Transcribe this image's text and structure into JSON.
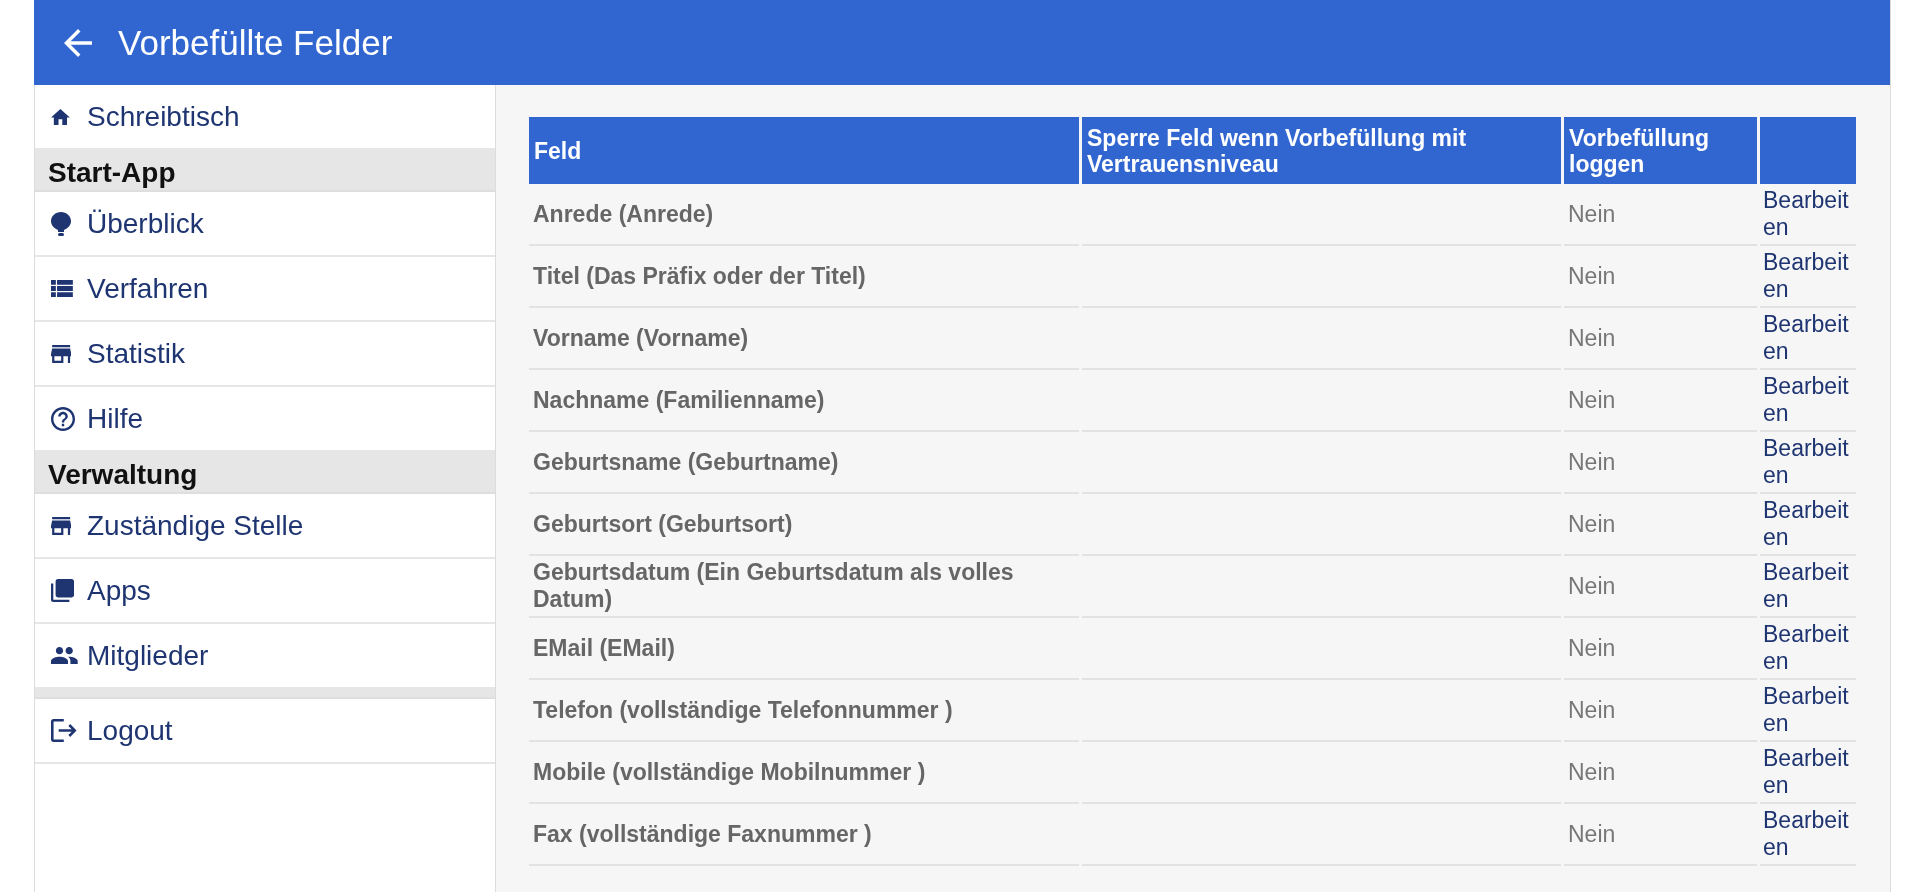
{
  "header": {
    "title": "Vorbefüllte Felder"
  },
  "sidebar": {
    "groups": [
      {
        "items": [
          {
            "label": "Schreibtisch"
          }
        ]
      },
      {
        "heading": "Start-App",
        "items": [
          {
            "label": "Überblick"
          },
          {
            "label": "Verfahren"
          },
          {
            "label": "Statistik"
          },
          {
            "label": "Hilfe"
          }
        ]
      },
      {
        "heading": "Verwaltung",
        "items": [
          {
            "label": "Zuständige Stelle"
          },
          {
            "label": "Apps"
          },
          {
            "label": "Mitglieder"
          }
        ]
      },
      {
        "items": [
          {
            "label": "Logout"
          }
        ]
      }
    ]
  },
  "table": {
    "columns": [
      "Feld",
      "Sperre Feld wenn Vorbefüllung mit Vertrauensniveau",
      "Vorbefüllung loggen"
    ],
    "rows": [
      {
        "field": "Anrede (Anrede)",
        "log": "Nein",
        "action": "Bearbeiten"
      },
      {
        "field": "Titel (Das Präfix oder der Titel)",
        "log": "Nein",
        "action": "Bearbeiten"
      },
      {
        "field": "Vorname (Vorname)",
        "log": "Nein",
        "action": "Bearbeiten"
      },
      {
        "field": "Nachname (Familienname)",
        "log": "Nein",
        "action": "Bearbeiten"
      },
      {
        "field": "Geburtsname (Geburtname)",
        "log": "Nein",
        "action": "Bearbeiten"
      },
      {
        "field": "Geburtsort (Geburtsort)",
        "log": "Nein",
        "action": "Bearbeiten"
      },
      {
        "field": "Geburtsdatum (Ein Geburtsdatum als volles Datum)",
        "log": "Nein",
        "action": "Bearbeiten"
      },
      {
        "field": "EMail (EMail)",
        "log": "Nein",
        "action": "Bearbeiten"
      },
      {
        "field": "Telefon (vollständige Telefonnummer )",
        "log": "Nein",
        "action": "Bearbeiten"
      },
      {
        "field": "Mobile (vollständige Mobilnummer )",
        "log": "Nein",
        "action": "Bearbeiten"
      },
      {
        "field": "Fax (vollständige Faxnummer )",
        "log": "Nein",
        "action": "Bearbeiten"
      }
    ]
  }
}
